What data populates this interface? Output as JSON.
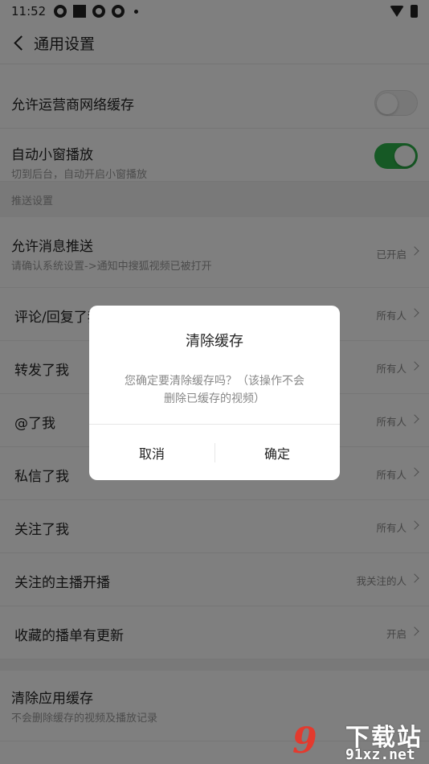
{
  "status_bar": {
    "time": "11:52"
  },
  "app_bar": {
    "title": "通用设置"
  },
  "settings": {
    "carrier_cache": {
      "label": "允许运营商网络缓存",
      "enabled": false
    },
    "mini_window": {
      "label": "自动小窗播放",
      "sub": "切到后台，自动开启小窗播放",
      "enabled": true
    }
  },
  "push_section": {
    "header": "推送设置",
    "allow_push": {
      "label": "允许消息推送",
      "sub": "请确认系统设置->通知中搜狐视频已被打开",
      "value": "已开启"
    },
    "items": [
      {
        "label": "评论/回复了我",
        "value": "所有人"
      },
      {
        "label": "转发了我",
        "value": "所有人"
      },
      {
        "label": "@了我",
        "value": "所有人"
      },
      {
        "label": "私信了我",
        "value": "所有人"
      },
      {
        "label": "关注了我",
        "value": "所有人"
      },
      {
        "label": "关注的主播开播",
        "value": "我关注的人"
      },
      {
        "label": "收藏的播单有更新",
        "value": "开启"
      }
    ]
  },
  "clear_cache": {
    "label": "清除应用缓存",
    "sub": "不会删除缓存的视频及播放记录"
  },
  "dialog": {
    "title": "清除缓存",
    "message": "您确定要清除缓存吗？（该操作不会删除已缓存的视频）",
    "cancel": "取消",
    "confirm": "确定"
  },
  "watermark": {
    "logo": "9",
    "top": "下载站",
    "bottom": "91xz.net"
  },
  "colors": {
    "toggle_on": "#2db34a",
    "watermark_red": "#e33a2e",
    "overlay": "rgba(0,0,0,0.5)"
  }
}
